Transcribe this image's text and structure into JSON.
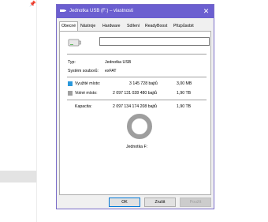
{
  "window": {
    "title": "Jednotka USB (F:) – vlastnosti",
    "accent": "#6b5fd0",
    "close_label": "✕"
  },
  "tabs": [
    {
      "label": "Obecné",
      "active": true
    },
    {
      "label": "Nástroje"
    },
    {
      "label": "Hardware"
    },
    {
      "label": "Sdílení"
    },
    {
      "label": "ReadyBoost"
    },
    {
      "label": "Přizpůsobit"
    }
  ],
  "general": {
    "name_value": "",
    "type_label": "Typ:",
    "type_value": "Jednotka USB",
    "fs_label": "Systém souborů:",
    "fs_value": "exFAT",
    "used": {
      "label": "Využité místo:",
      "bytes": "3 145 728 bajtů",
      "size": "3,00 MB",
      "color": "#2a98dc"
    },
    "free": {
      "label": "Volné místo:",
      "bytes": "2 097 131 028 480 bajtů",
      "size": "1,90 TB",
      "color": "#a0a0a0"
    },
    "capacity": {
      "label": "Kapacita:",
      "bytes": "2 097 134 174 208 bajtů",
      "size": "1,90 TB"
    },
    "drive_label": "Jednotka F:"
  },
  "buttons": {
    "ok": "OK",
    "cancel": "Zrušit",
    "apply": "Použít"
  }
}
